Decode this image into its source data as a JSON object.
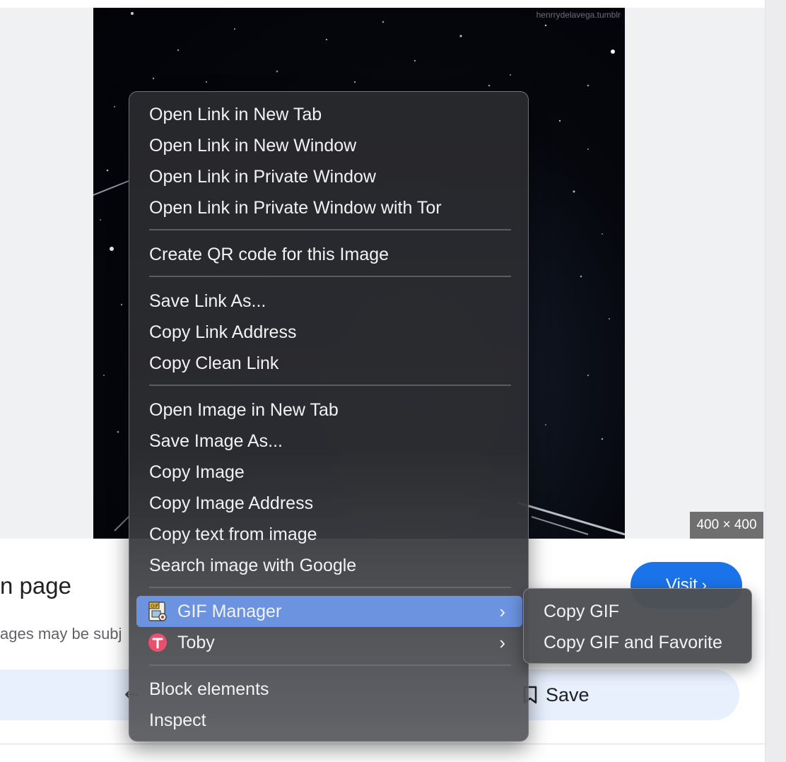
{
  "image": {
    "watermark": "henrrydelavega.tumblr",
    "size_badge": "400 × 400"
  },
  "result": {
    "title_partial": "n page",
    "desc_partial": "ages may be subj",
    "visit_label": "Visit",
    "visit_chevron": "›",
    "save_label": "Save"
  },
  "context_menu": {
    "open_new_tab": "Open Link in New Tab",
    "open_new_window": "Open Link in New Window",
    "open_private": "Open Link in Private Window",
    "open_private_tor": "Open Link in Private Window with Tor",
    "create_qr": "Create QR code for this Image",
    "save_link_as": "Save Link As...",
    "copy_link_address": "Copy Link Address",
    "copy_clean_link": "Copy Clean Link",
    "open_image_new_tab": "Open Image in New Tab",
    "save_image_as": "Save Image As...",
    "copy_image": "Copy Image",
    "copy_image_address": "Copy Image Address",
    "copy_text_from_image": "Copy text from image",
    "search_image_google": "Search image with Google",
    "gif_manager": "GIF Manager",
    "toby": "Toby",
    "block_elements": "Block elements",
    "inspect": "Inspect",
    "highlight_color": "#6b93e0"
  },
  "submenu": {
    "copy_gif": "Copy GIF",
    "copy_gif_favorite": "Copy GIF and Favorite"
  },
  "icons": {
    "gif_manager": "gif-file-icon",
    "toby": "toby-logo-icon",
    "save": "bookmark-icon"
  }
}
